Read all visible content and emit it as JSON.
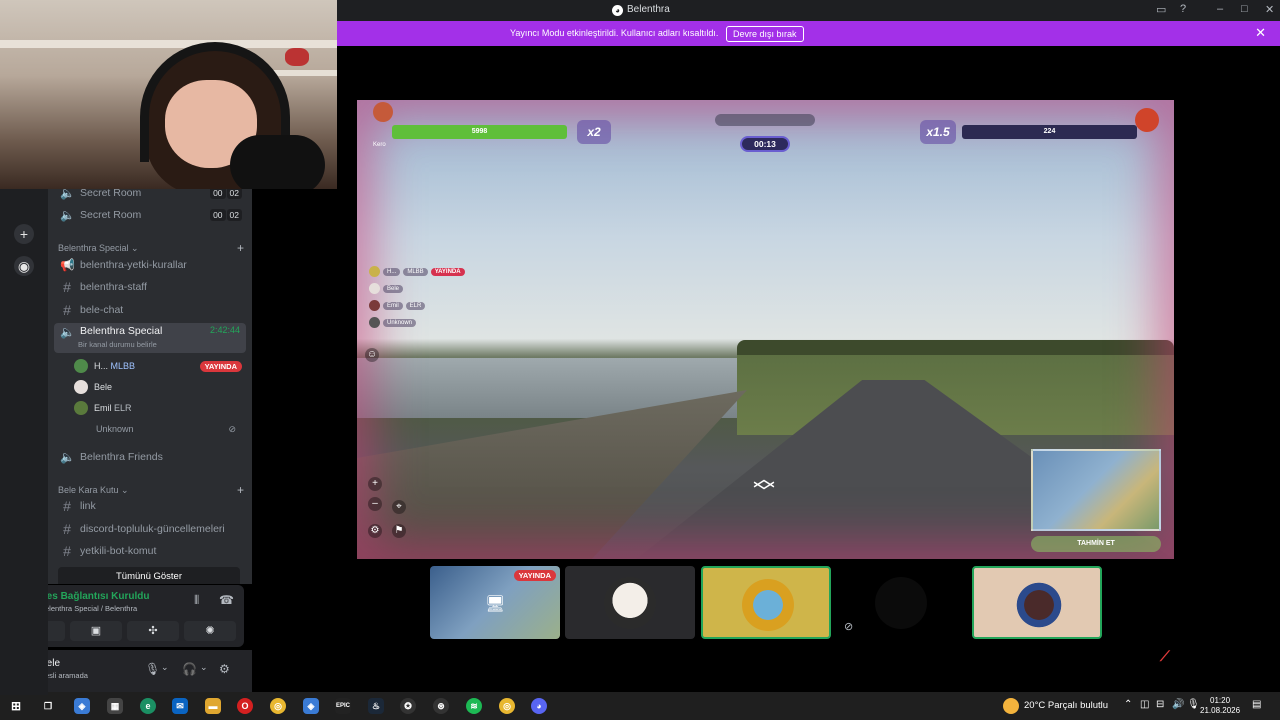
{
  "window": {
    "title": "Belenthra"
  },
  "banner": {
    "message": "Yayıncı Modu etkinleştirildi. Kullanıcı adları kısaltıldı.",
    "disable_label": "Devre dışı bırak"
  },
  "channels": {
    "top_rooms": [
      {
        "name": "Secret Room",
        "count_a": "00",
        "count_b": "02"
      },
      {
        "name": "Secret Room",
        "count_a": "00",
        "count_b": "02"
      }
    ],
    "category1": "Belenthra Special",
    "text_channels_1": [
      {
        "name": "belenthra-yetki-kurallar"
      },
      {
        "name": "belenthra-staff"
      },
      {
        "name": "bele-chat"
      }
    ],
    "active_voice": {
      "name": "Belenthra Special",
      "time": "2:42:44",
      "status_hint": "Bir kanal durumu belirle"
    },
    "voice_users": [
      {
        "name": "H...",
        "tag": "MLBB",
        "live": "YAYINDA"
      },
      {
        "name": "Bele",
        "tag": "",
        "live": ""
      },
      {
        "name": "Emil",
        "tag": "ELR",
        "live": ""
      },
      {
        "name": "Unknown",
        "tag": "",
        "live": ""
      }
    ],
    "friends_voice": "Belenthra Friends",
    "category2": "Bele Kara Kutu",
    "text_channels_2": [
      {
        "name": "link"
      },
      {
        "name": "discord-topluluk-güncellemeleri"
      },
      {
        "name": "yetkili-bot-komut"
      }
    ],
    "show_all": "Tümünü Göster"
  },
  "voice_panel": {
    "title": "Ses Bağlantısı Kuruldu",
    "subtitle": "Belenthra Special / Belenthra"
  },
  "user_panel": {
    "name": "Bele",
    "status": "Sesli aramada"
  },
  "game": {
    "player_left_hp": "5998",
    "player_left_name": "Kero",
    "multiplier_left": "x2",
    "timer": "00:13",
    "multiplier_right": "x1.5",
    "player_right_hp": "224",
    "player_list": [
      {
        "name": "H...",
        "tag": "MLBB",
        "live": "YAYINDA"
      },
      {
        "name": "Bele",
        "tag": "",
        "live": ""
      },
      {
        "name": "Emil",
        "tag": "ELR",
        "live": ""
      },
      {
        "name": "Unknown",
        "tag": "",
        "live": ""
      }
    ],
    "guess_label": "TAHMİN ET"
  },
  "tiles": {
    "live_label": "YAYINDA"
  },
  "taskbar": {
    "weather": "20°C  Parçalı bulutlu",
    "time": "01:20",
    "date": "21.08.2026"
  },
  "colors": {
    "accent": "#a330e8",
    "green": "#23a55a",
    "live": "#da373c"
  }
}
